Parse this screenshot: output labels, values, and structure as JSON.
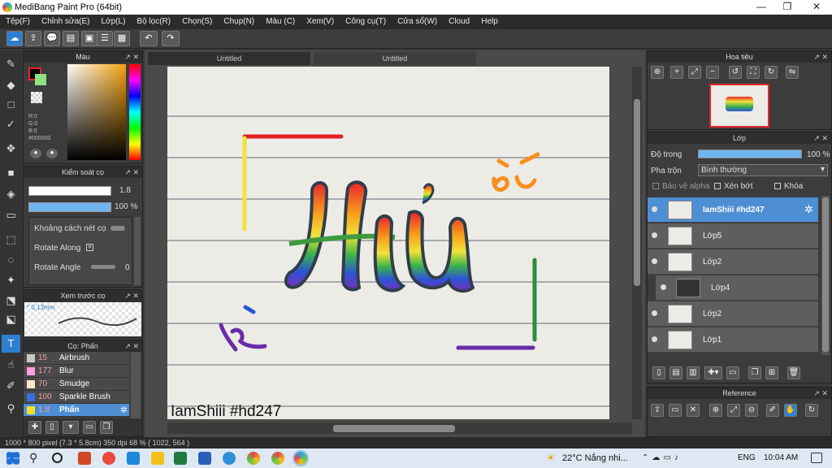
{
  "window": {
    "title": "MediBang Paint Pro (64bit)",
    "minimize": "—",
    "restore": "❐",
    "close": "✕"
  },
  "menu": [
    "Tệp(F)",
    "Chỉnh sửa(E)",
    "Lớp(L)",
    "Bộ lọc(R)",
    "Chọn(S)",
    "Chụp(N)",
    "Màu (C)",
    "Xem(V)",
    "Công cụ(T)",
    "Cửa sổ(W)",
    "Cloud",
    "Help"
  ],
  "doc_tabs": [
    "Untitled",
    "Untitled"
  ],
  "color_panel": {
    "title": "Màu",
    "r": "R:0",
    "g": "G:0",
    "b": "B:0",
    "hex": "#000000"
  },
  "brush_control": {
    "title": "Kiểm soát cọ",
    "size": "1.8",
    "opacity": "100 %",
    "spacing_label": "Khoảng cách nét cọ",
    "rotate_along": "Rotate Along",
    "rotate_angle": "Rotate Angle",
    "rotate_angle_value": "0"
  },
  "brush_preview": {
    "title": "Xem trước cọ",
    "size": "* 0.13mm"
  },
  "brush_list": {
    "title": "Cọ: Phấn",
    "items": [
      {
        "size": "15",
        "name": "Airbrush",
        "color": "#c8c8c8"
      },
      {
        "size": "177",
        "name": "Blur",
        "color": "#ff9ee0"
      },
      {
        "size": "70",
        "name": "Smudge",
        "color": "#fde7c8"
      },
      {
        "size": "100",
        "name": "Sparkle Brush",
        "color": "#3b6de0"
      },
      {
        "size": "1.8",
        "name": "Phấn",
        "color": "#f3e02a"
      }
    ]
  },
  "canvas": {
    "caption": "IamShiii #hd247"
  },
  "navigator": {
    "title": "Hoa tiêu"
  },
  "layer_panel": {
    "title": "Lớp",
    "opacity_label": "Độ trong",
    "opacity_value": "100 %",
    "blend_label": "Pha trộn",
    "blend_value": "Bình thường",
    "protect_alpha": "Bảo vệ alpha",
    "clip": "Xén bớt",
    "lock": "Khóa",
    "layers": [
      "IamShiii #hd247",
      "Lớp5",
      "Lớp2",
      "Lớp4",
      "Lớp2",
      "Lớp1"
    ]
  },
  "reference": {
    "title": "Reference"
  },
  "status": {
    "text": "1000 * 800 pixel   (7.3 * 5.8cm)   350 dpi   68 %   ( 1022, 564 )"
  },
  "taskbar": {
    "weather": "22°C  Nắng nhi...",
    "lang": "ENG",
    "time": "10:04 AM"
  },
  "colors": {
    "accent": "#2f7fd0",
    "selected_layer": "#4e8fd4",
    "opacity_bar": "#6fb3ef"
  }
}
